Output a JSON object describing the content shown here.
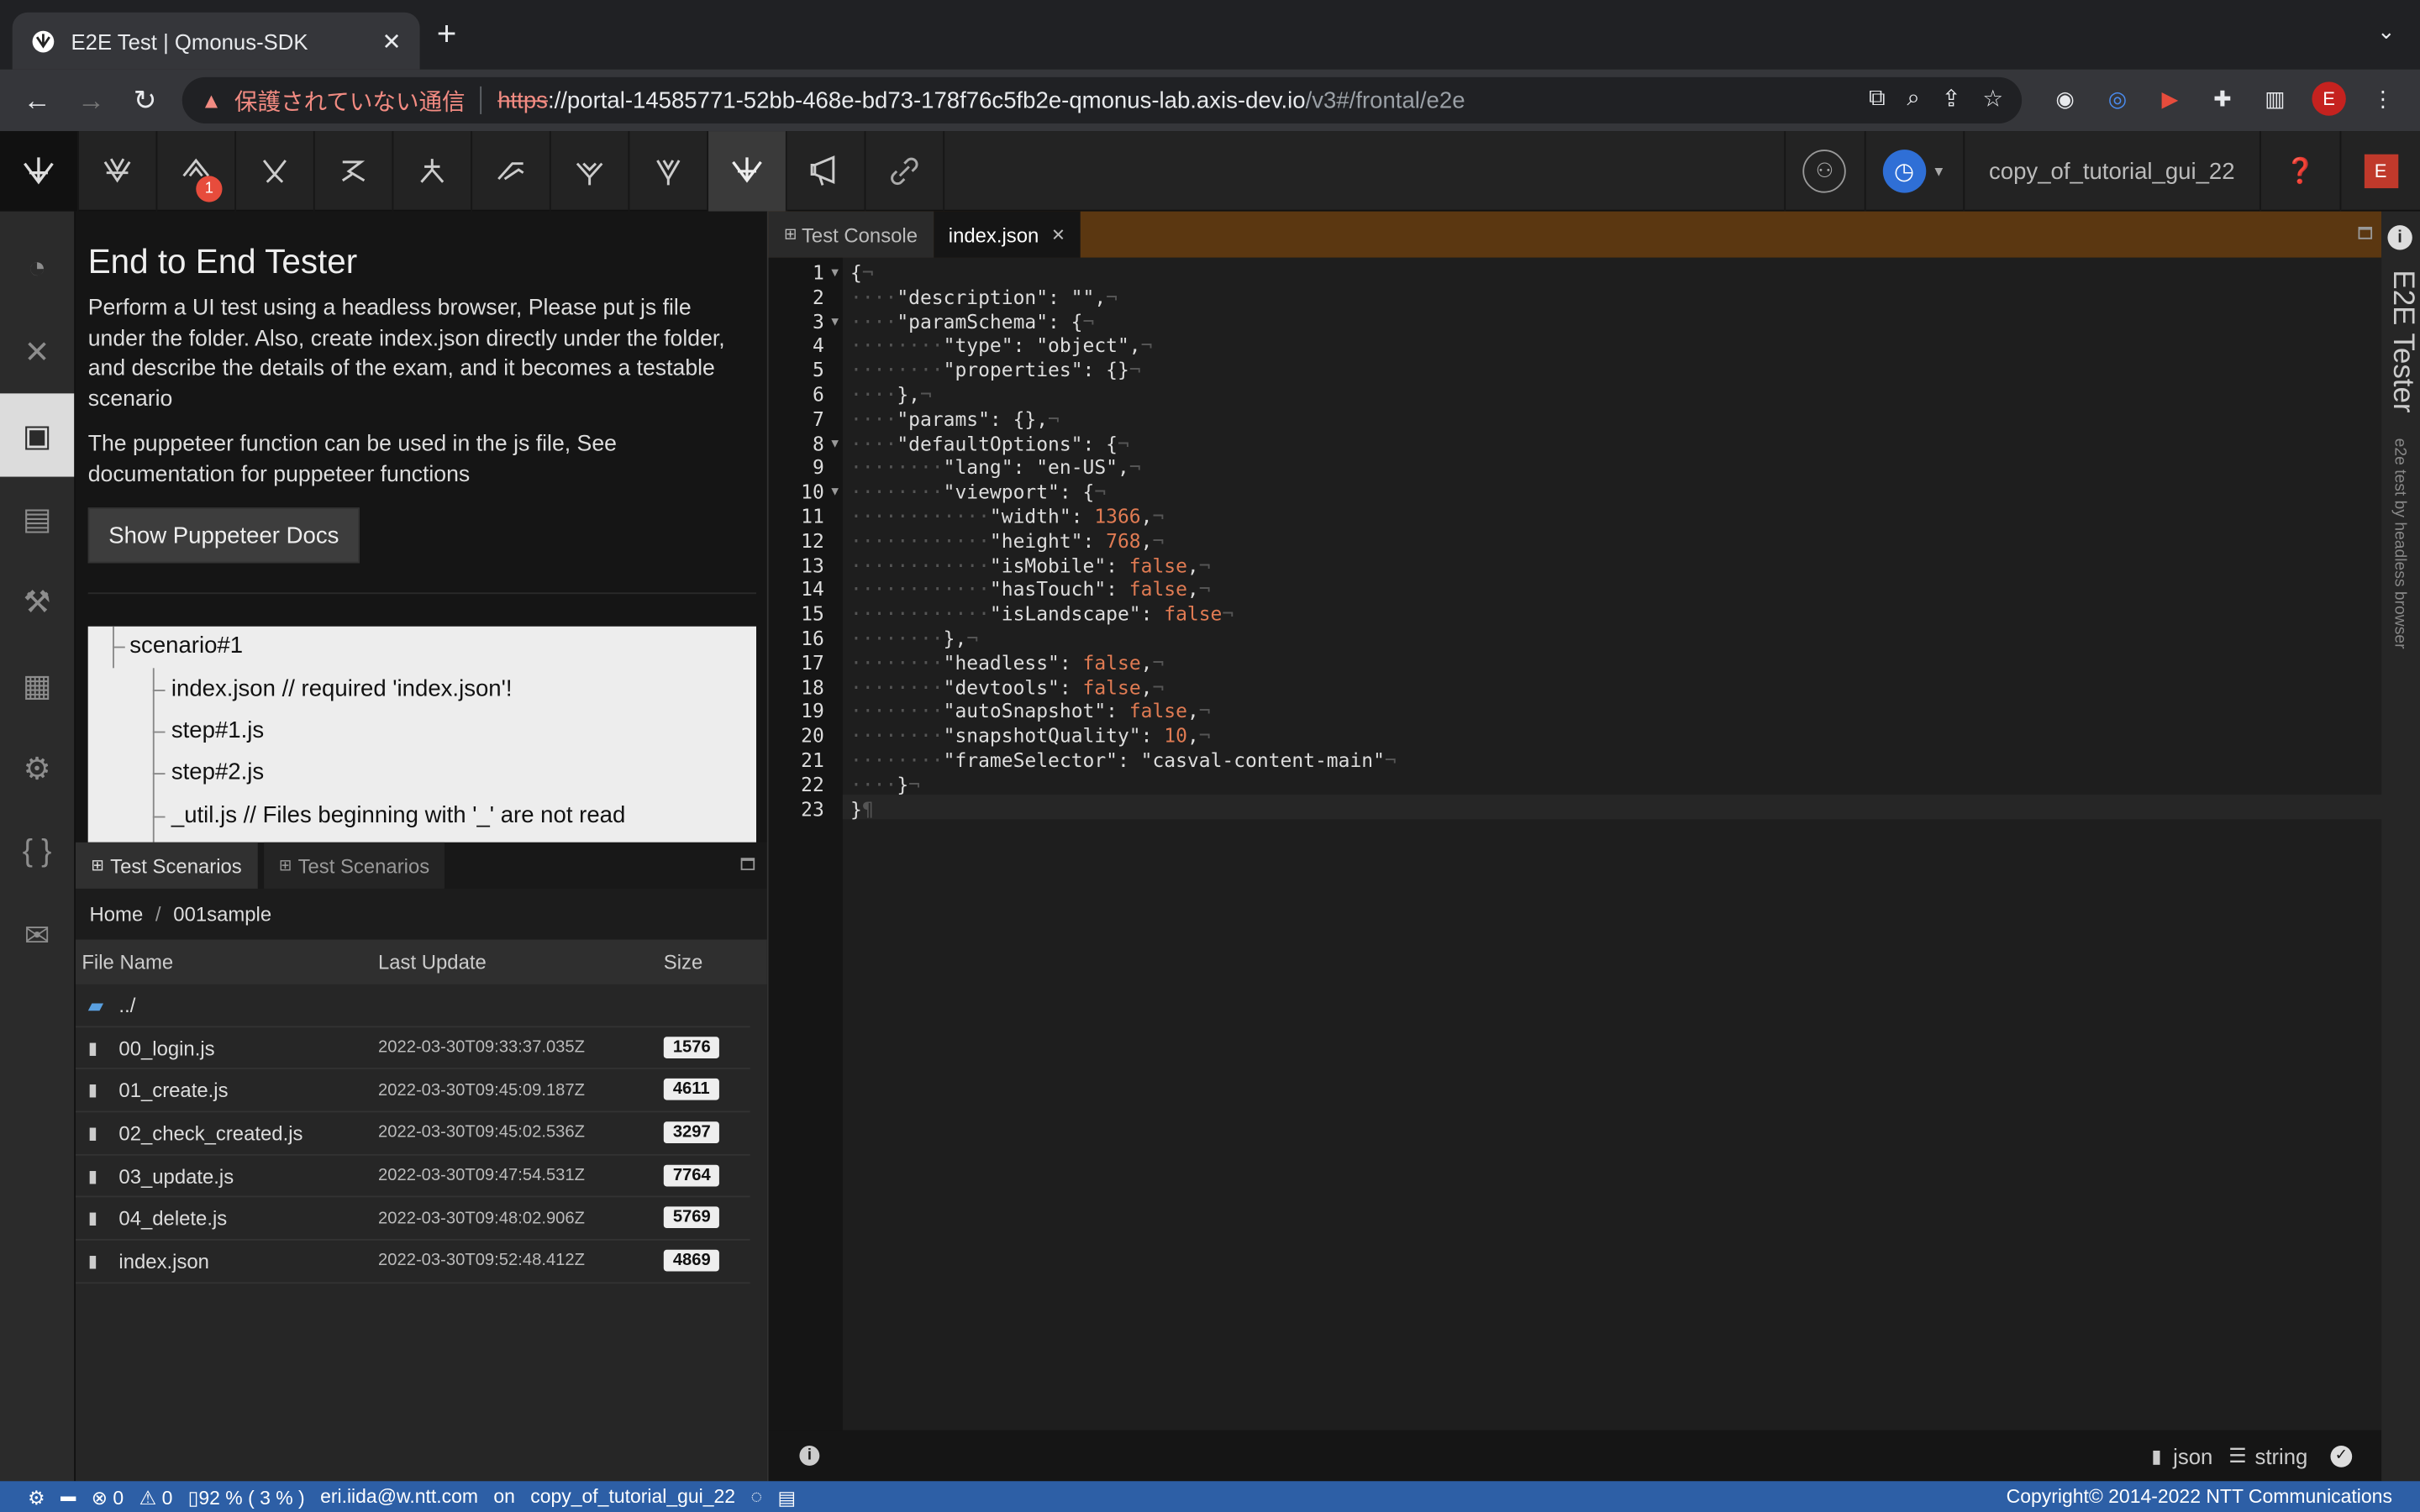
{
  "browser": {
    "tab_title": "E2E Test | Qmonus-SDK",
    "new_tab": "+",
    "tab_close": "✕",
    "tab_menu": "⌄",
    "security_text": "保護されていない通信",
    "url_scheme": "https",
    "url_host": "://portal-14585771-52bb-468e-bd73-178f76c5fb2e-qmonus-lab.axis-dev.io",
    "url_path": "/v3#/frontal/e2e",
    "profile_initial": "E"
  },
  "app_header": {
    "notification_count": "1",
    "project_name": "copy_of_tutorial_gui_22",
    "user_initial": "E"
  },
  "description": {
    "title": "End to End Tester",
    "paragraph1": "Perform a UI test using a headless browser, Please put js file under the folder. Also, create index.json directly under the folder, and describe the details of the exam, and it becomes a testable scenario",
    "paragraph2": "The puppeteer function can be used in the js file, See documentation for puppeteer functions",
    "docs_button": "Show Puppeteer Docs",
    "tree": [
      "scenario#1",
      "index.json // required 'index.json'!",
      "step#1.js",
      "step#2.js",
      "_util.js // Files beginning with '_' are not read"
    ]
  },
  "scenarios": {
    "tabs": [
      "Test Scenarios",
      "Test Scenarios"
    ],
    "breadcrumb": [
      "Home",
      "/",
      "001sample"
    ],
    "columns": [
      "File Name",
      "Last Update",
      "Size"
    ],
    "parent_dir": "../",
    "files": [
      {
        "name": "00_login.js",
        "updated": "2022-03-30T09:33:37.035Z",
        "size": "1576"
      },
      {
        "name": "01_create.js",
        "updated": "2022-03-30T09:45:09.187Z",
        "size": "4611"
      },
      {
        "name": "02_check_created.js",
        "updated": "2022-03-30T09:45:02.536Z",
        "size": "3297"
      },
      {
        "name": "03_update.js",
        "updated": "2022-03-30T09:47:54.531Z",
        "size": "7764"
      },
      {
        "name": "04_delete.js",
        "updated": "2022-03-30T09:48:02.906Z",
        "size": "5769"
      },
      {
        "name": "index.json",
        "updated": "2022-03-30T09:52:48.412Z",
        "size": "4869"
      }
    ]
  },
  "editor": {
    "tabs": [
      "Test Console",
      "index.json"
    ],
    "tab_close": "✕",
    "mode_label": "json",
    "type_label": "string",
    "lines": [
      "{",
      "    \"description\": \"\",",
      "    \"paramSchema\": {",
      "        \"type\": \"object\",",
      "        \"properties\": {}",
      "    },",
      "    \"params\": {},",
      "    \"defaultOptions\": {",
      "        \"lang\": \"en-US\",",
      "        \"viewport\": {",
      "            \"width\": 1366,",
      "            \"height\": 768,",
      "            \"isMobile\": false,",
      "            \"hasTouch\": false,",
      "            \"isLandscape\": false",
      "        },",
      "        \"headless\": false,",
      "        \"devtools\": false,",
      "        \"autoSnapshot\": false,",
      "        \"snapshotQuality\": 10,",
      "        \"frameSelector\": \"casval-content-main\"",
      "    }",
      "}"
    ],
    "fold_lines": [
      1,
      3,
      8,
      10
    ]
  },
  "rail": {
    "title": "E2E Tester",
    "subtitle": "e2e test by headless browser"
  },
  "status_bar": {
    "errors": "0",
    "warnings": "0",
    "memory": "92 % ( 3 % )",
    "user": "eri.iida@w.ntt.com",
    "on": "on",
    "project": "copy_of_tutorial_gui_22",
    "copyright": "Copyright© 2014-2022 NTT Communications"
  }
}
